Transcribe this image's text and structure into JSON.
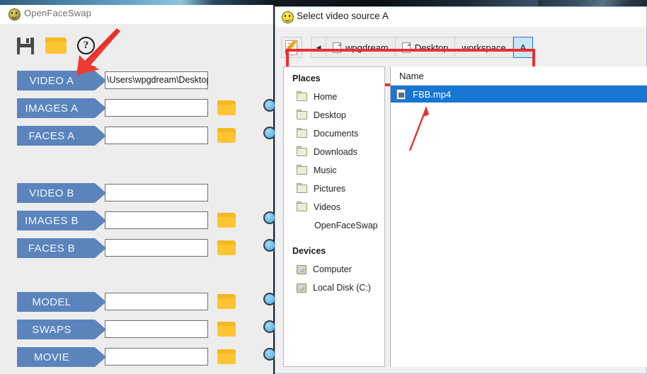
{
  "desktop": {
    "background_color": "#16202a"
  },
  "main_window": {
    "title": "OpenFaceSwap",
    "title_icon": "smiley-icon",
    "toolbar": {
      "save_label": "save-icon",
      "open_label": "folder-open-icon",
      "help_label": "?"
    },
    "rows": [
      {
        "label": "VIDEO A",
        "value": "\\Users\\wpgdream\\Desktop'",
        "has_folder": false,
        "has_search": false
      },
      {
        "label": "IMAGES A",
        "value": "",
        "has_folder": true,
        "has_search": true
      },
      {
        "label": "FACES A",
        "value": "",
        "has_folder": true,
        "has_search": true
      },
      {
        "label": "VIDEO B",
        "value": "",
        "has_folder": false,
        "has_search": false
      },
      {
        "label": "IMAGES B",
        "value": "",
        "has_folder": true,
        "has_search": true
      },
      {
        "label": "FACES B",
        "value": "",
        "has_folder": true,
        "has_search": true
      },
      {
        "label": "MODEL",
        "value": "",
        "has_folder": true,
        "has_search": true
      },
      {
        "label": "SWAPS",
        "value": "",
        "has_folder": true,
        "has_search": true
      },
      {
        "label": "MOVIE",
        "value": "",
        "has_folder": true,
        "has_search": true
      }
    ],
    "accent_color": "#5b84bd"
  },
  "dialog": {
    "title": "Select video source A",
    "title_icon": "smiley-icon",
    "edit_path_button": "edit-path-icon",
    "back_button": "◀",
    "breadcrumbs": [
      {
        "label": "wpgdream",
        "icon": true,
        "active": false
      },
      {
        "label": "Desktop",
        "icon": true,
        "active": false
      },
      {
        "label": "workspace",
        "icon": false,
        "active": false
      },
      {
        "label": "A",
        "icon": false,
        "active": true
      }
    ],
    "sidebar": {
      "places_header": "Places",
      "places": [
        {
          "label": "Home",
          "type": "folder"
        },
        {
          "label": "Desktop",
          "type": "folder"
        },
        {
          "label": "Documents",
          "type": "folder"
        },
        {
          "label": "Downloads",
          "type": "folder"
        },
        {
          "label": "Music",
          "type": "folder"
        },
        {
          "label": "Pictures",
          "type": "folder"
        },
        {
          "label": "Videos",
          "type": "folder"
        },
        {
          "label": "OpenFaceSwap",
          "type": "none"
        }
      ],
      "devices_header": "Devices",
      "devices": [
        {
          "label": "Computer",
          "type": "disk"
        },
        {
          "label": "Local Disk (C:)",
          "type": "disk"
        }
      ]
    },
    "file_list": {
      "column_header": "Name",
      "rows": [
        {
          "name": "FBB.mp4",
          "selected": true
        }
      ],
      "selection_color": "#1676d2"
    }
  },
  "annotations": {
    "highlight_color": "#ec2f2f",
    "arrow_color": "#e8302a",
    "items": [
      {
        "name": "arrow-to-video-a"
      },
      {
        "name": "arrow-to-file-fbb"
      },
      {
        "name": "breadcrumb-highlight-box"
      }
    ]
  }
}
